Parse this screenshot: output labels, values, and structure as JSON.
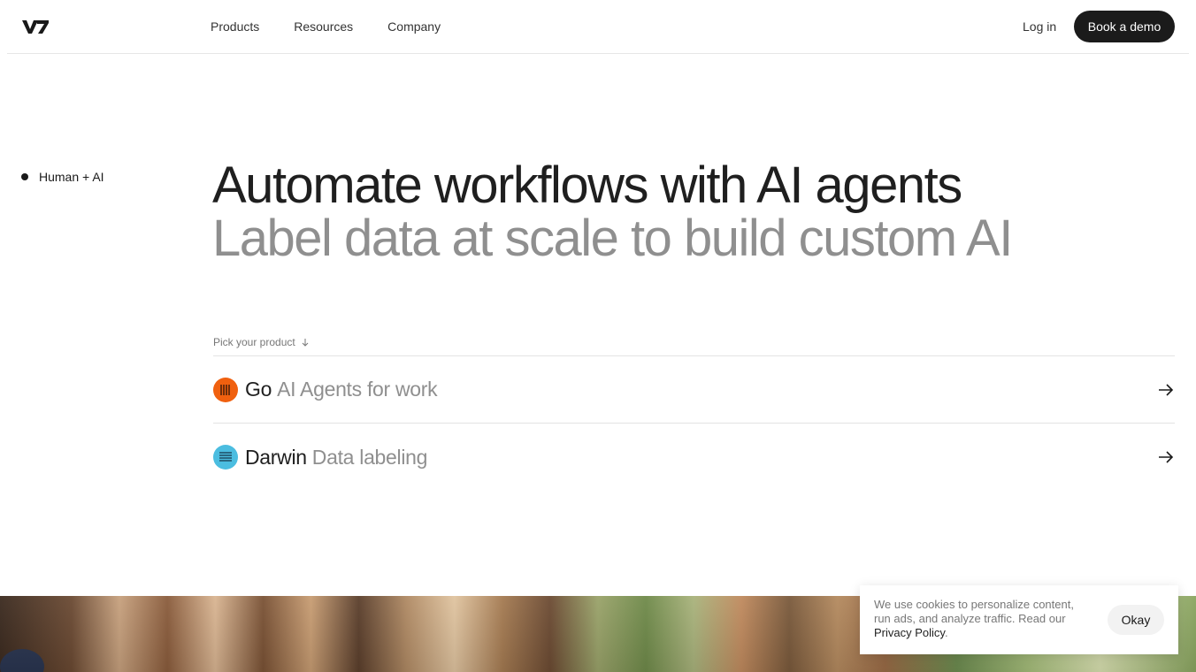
{
  "nav": {
    "logo_text": "V7",
    "links": [
      "Products",
      "Resources",
      "Company"
    ],
    "login": "Log in",
    "demo": "Book a demo"
  },
  "side_tag": "Human + AI",
  "hero": {
    "line1": "Automate workflows with AI agents",
    "line2": "Label data at scale to build custom AI"
  },
  "pick": {
    "label": "Pick your product",
    "icon": "arrow-down-icon"
  },
  "products": [
    {
      "name": "Go",
      "desc": "AI Agents for work",
      "icon": "go-logo-icon",
      "color": "#f0600f"
    },
    {
      "name": "Darwin",
      "desc": "Data labeling",
      "icon": "darwin-logo-icon",
      "color": "#4bbde0"
    }
  ],
  "cookie": {
    "text1": "We use cookies to personalize content, run ads, and analyze traffic. Read our ",
    "link": "Privacy Policy",
    "text2": ".",
    "button": "Okay"
  }
}
